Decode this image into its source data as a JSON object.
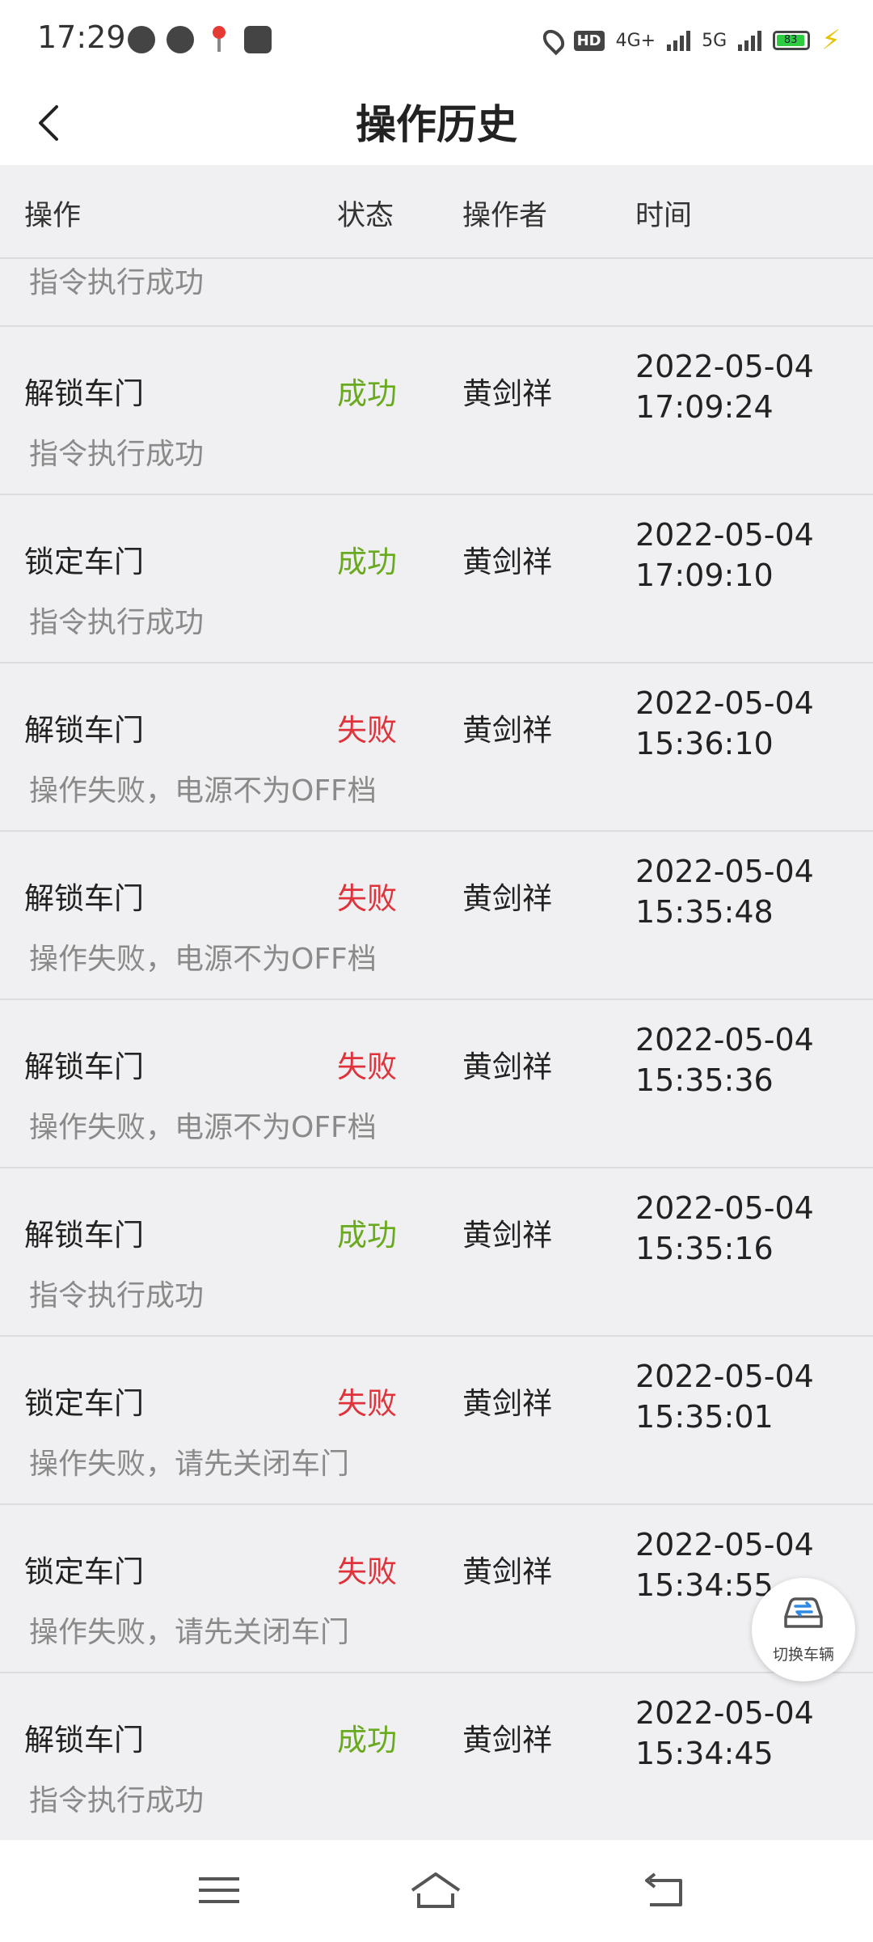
{
  "status_bar": {
    "time": "17:29",
    "battery": "83",
    "hd": "HD",
    "net1": "4G+",
    "net2": "5G"
  },
  "header": {
    "title": "操作历史"
  },
  "columns": {
    "operation": "操作",
    "status": "状态",
    "operator": "操作者",
    "time": "时间"
  },
  "partial_row": {
    "message": "指令执行成功"
  },
  "rows": [
    {
      "operation": "解锁车门",
      "status": "成功",
      "status_type": "ok",
      "operator": "黄剑祥",
      "date": "2022-05-04",
      "time": "17:09:24",
      "message": "指令执行成功"
    },
    {
      "operation": "锁定车门",
      "status": "成功",
      "status_type": "ok",
      "operator": "黄剑祥",
      "date": "2022-05-04",
      "time": "17:09:10",
      "message": "指令执行成功"
    },
    {
      "operation": "解锁车门",
      "status": "失败",
      "status_type": "fail",
      "operator": "黄剑祥",
      "date": "2022-05-04",
      "time": "15:36:10",
      "message": "操作失败，电源不为OFF档"
    },
    {
      "operation": "解锁车门",
      "status": "失败",
      "status_type": "fail",
      "operator": "黄剑祥",
      "date": "2022-05-04",
      "time": "15:35:48",
      "message": "操作失败，电源不为OFF档"
    },
    {
      "operation": "解锁车门",
      "status": "失败",
      "status_type": "fail",
      "operator": "黄剑祥",
      "date": "2022-05-04",
      "time": "15:35:36",
      "message": "操作失败，电源不为OFF档"
    },
    {
      "operation": "解锁车门",
      "status": "成功",
      "status_type": "ok",
      "operator": "黄剑祥",
      "date": "2022-05-04",
      "time": "15:35:16",
      "message": "指令执行成功"
    },
    {
      "operation": "锁定车门",
      "status": "失败",
      "status_type": "fail",
      "operator": "黄剑祥",
      "date": "2022-05-04",
      "time": "15:35:01",
      "message": "操作失败，请先关闭车门"
    },
    {
      "operation": "锁定车门",
      "status": "失败",
      "status_type": "fail",
      "operator": "黄剑祥",
      "date": "2022-05-04",
      "time": "15:34:55",
      "message": "操作失败，请先关闭车门"
    },
    {
      "operation": "解锁车门",
      "status": "成功",
      "status_type": "ok",
      "operator": "黄剑祥",
      "date": "2022-05-04",
      "time": "15:34:45",
      "message": "指令执行成功"
    }
  ],
  "fab": {
    "label": "切换车辆",
    "icon": "car-switch-icon"
  },
  "colors": {
    "success": "#6aaa1e",
    "fail": "#e0323a",
    "secondary_text": "#8a8a8a"
  }
}
